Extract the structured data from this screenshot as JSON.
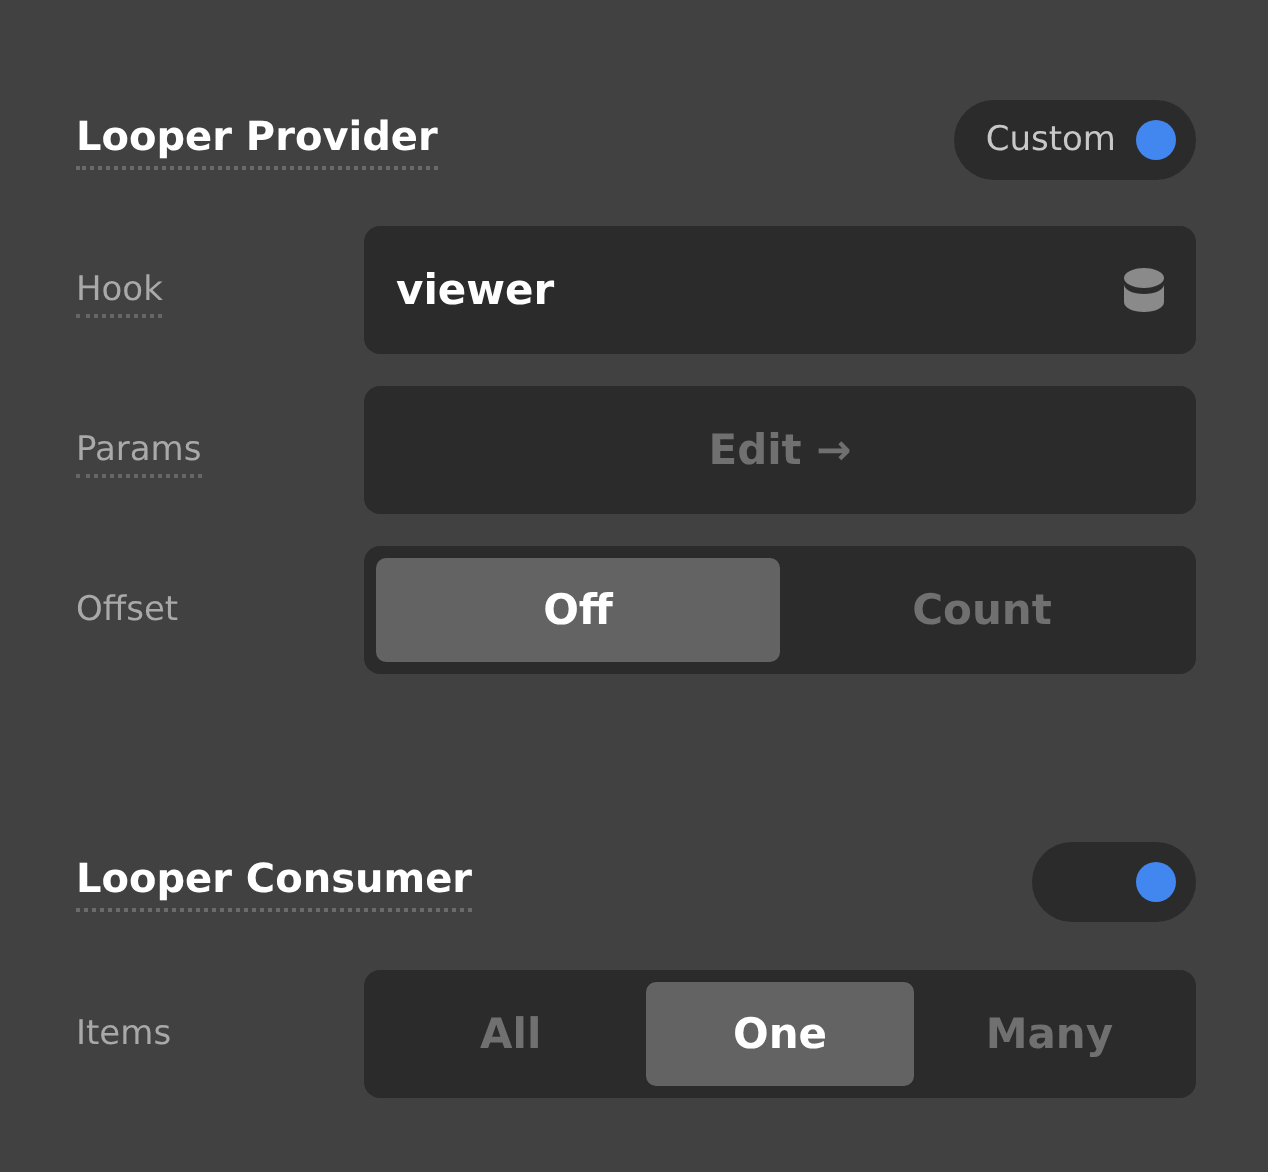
{
  "sections": [
    {
      "title": "Looper Provider",
      "toggle": {
        "label": "Custom",
        "on": true
      },
      "rows": [
        {
          "kind": "field",
          "label": "Hook",
          "underlined": true,
          "value": "viewer"
        },
        {
          "kind": "button",
          "label": "Params",
          "underlined": true,
          "text": "Edit →"
        },
        {
          "kind": "segmented",
          "label": "Offset",
          "underlined": false,
          "options": [
            {
              "label": "Off",
              "selected": true
            },
            {
              "label": "Count",
              "selected": false
            }
          ]
        }
      ]
    },
    {
      "title": "Looper Consumer",
      "toggle": {
        "on": true
      },
      "rows": [
        {
          "kind": "segmented",
          "label": "Items",
          "underlined": false,
          "options": [
            {
              "label": "All",
              "selected": false
            },
            {
              "label": "One",
              "selected": true
            },
            {
              "label": "Many",
              "selected": false
            }
          ]
        }
      ]
    }
  ]
}
